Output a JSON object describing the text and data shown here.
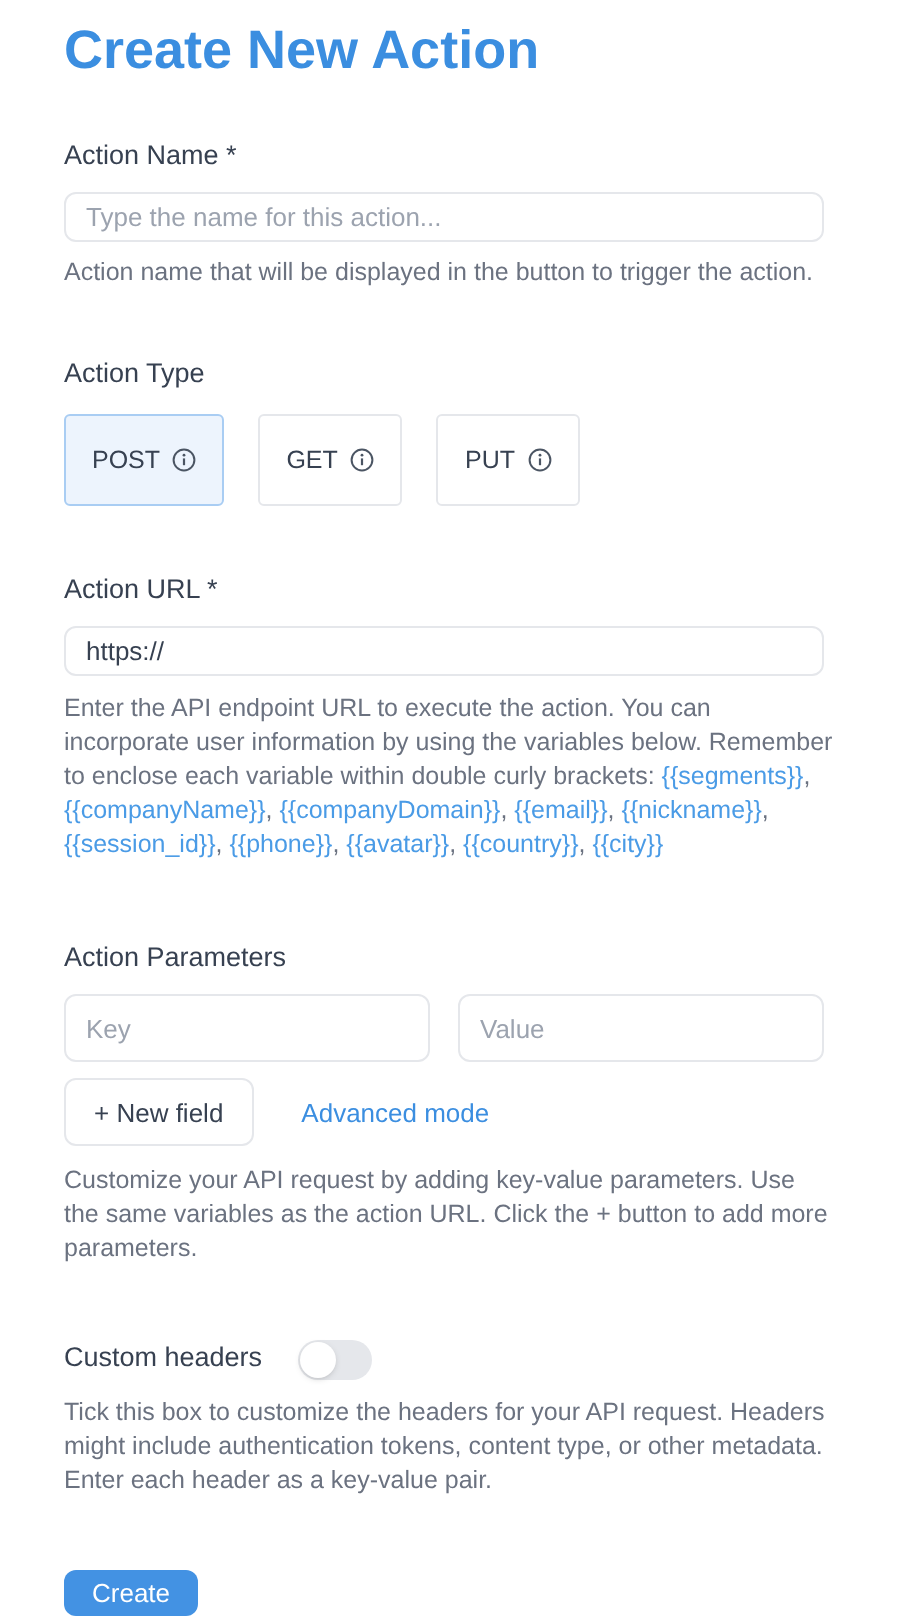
{
  "title": "Create New Action",
  "action_name": {
    "label": "Action Name *",
    "placeholder": "Type the name for this action...",
    "help": "Action name that will be displayed in the button to trigger the action."
  },
  "action_type": {
    "label": "Action Type",
    "options": [
      {
        "label": "POST",
        "selected": true
      },
      {
        "label": "GET",
        "selected": false
      },
      {
        "label": "PUT",
        "selected": false
      }
    ]
  },
  "action_url": {
    "label": "Action URL *",
    "value": "https://",
    "help": [
      {
        "kind": "text",
        "text": "Enter the API endpoint URL to execute the action. You can incorporate user information by using the variables below. Remember to enclose each variable within double curly brackets: "
      },
      {
        "kind": "variable",
        "text": "{{segments}}"
      },
      {
        "kind": "text",
        "text": ", "
      },
      {
        "kind": "variable",
        "text": "{{companyName}}"
      },
      {
        "kind": "text",
        "text": ", "
      },
      {
        "kind": "variable",
        "text": "{{companyDomain}}"
      },
      {
        "kind": "text",
        "text": ", "
      },
      {
        "kind": "variable",
        "text": "{{email}}"
      },
      {
        "kind": "text",
        "text": ", "
      },
      {
        "kind": "variable",
        "text": "{{nickname}}"
      },
      {
        "kind": "text",
        "text": ", "
      },
      {
        "kind": "variable",
        "text": "{{session_id}}"
      },
      {
        "kind": "text",
        "text": ", "
      },
      {
        "kind": "variable",
        "text": "{{phone}}"
      },
      {
        "kind": "text",
        "text": ", "
      },
      {
        "kind": "variable",
        "text": "{{avatar}}"
      },
      {
        "kind": "text",
        "text": ", "
      },
      {
        "kind": "variable",
        "text": "{{country}}"
      },
      {
        "kind": "text",
        "text": ", "
      },
      {
        "kind": "variable",
        "text": "{{city}}"
      }
    ]
  },
  "action_parameters": {
    "label": "Action Parameters",
    "key_placeholder": "Key",
    "value_placeholder": "Value",
    "new_field_button": "+ New field",
    "advanced_link": "Advanced mode",
    "help": "Customize your API request by adding key-value parameters. Use the same variables as the action URL. Click the + button to add more parameters."
  },
  "custom_headers": {
    "label": "Custom headers",
    "on": false,
    "help": "Tick this box to customize the headers for your API request. Headers might include authentication tokens, content type, or other metadata. Enter each header as a key-value pair."
  },
  "submit_button": "Create"
}
